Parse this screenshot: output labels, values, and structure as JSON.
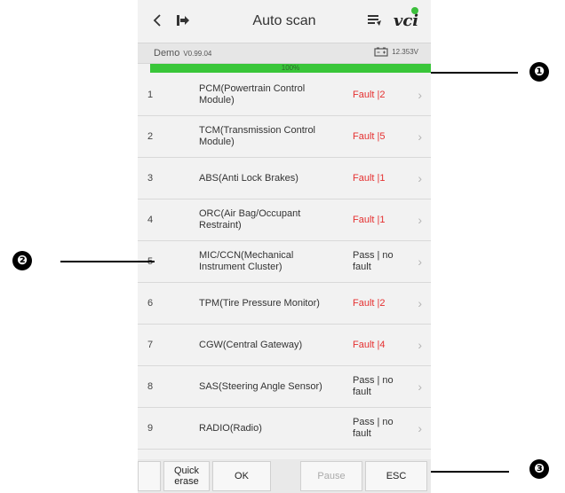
{
  "header": {
    "back_icon": "chevron-left-icon",
    "exit_icon": "exit-icon",
    "title": "Auto scan",
    "report_icon": "report-icon",
    "vci_label": "vci",
    "vci_status_color": "#3cbf3c"
  },
  "subbar": {
    "demo": "Demo",
    "version": "V0.99.04",
    "voltage": "12.353V",
    "battery_icon": "battery-icon"
  },
  "progress": {
    "value": 1.0,
    "label": "100%",
    "color": "#39c639"
  },
  "systems": [
    {
      "num": "1",
      "name": "PCM(Powertrain Control Module)",
      "status": "Fault |2",
      "fault": true
    },
    {
      "num": "2",
      "name": "TCM(Transmission Control Module)",
      "status": "Fault |5",
      "fault": true
    },
    {
      "num": "3",
      "name": "ABS(Anti Lock Brakes)",
      "status": "Fault |1",
      "fault": true
    },
    {
      "num": "4",
      "name": "ORC(Air Bag/Occupant Restraint)",
      "status": "Fault |1",
      "fault": true
    },
    {
      "num": "5",
      "name": "MIC/CCN(Mechanical Instrument Cluster)",
      "status": "Pass | no fault",
      "fault": false
    },
    {
      "num": "6",
      "name": "TPM(Tire Pressure Monitor)",
      "status": "Fault |2",
      "fault": true
    },
    {
      "num": "7",
      "name": "CGW(Central Gateway)",
      "status": "Fault |4",
      "fault": true
    },
    {
      "num": "8",
      "name": "SAS(Steering Angle Sensor)",
      "status": "Pass | no fault",
      "fault": false
    },
    {
      "num": "9",
      "name": "RADIO(Radio)",
      "status": "Pass | no fault",
      "fault": false
    }
  ],
  "toolbar": {
    "quick_erase": "Quick erase",
    "ok": "OK",
    "pause": "Pause",
    "esc": "ESC"
  },
  "callouts": [
    "❶",
    "❷",
    "❸"
  ],
  "colors": {
    "fault": "#e53030",
    "progress": "#39c639"
  }
}
